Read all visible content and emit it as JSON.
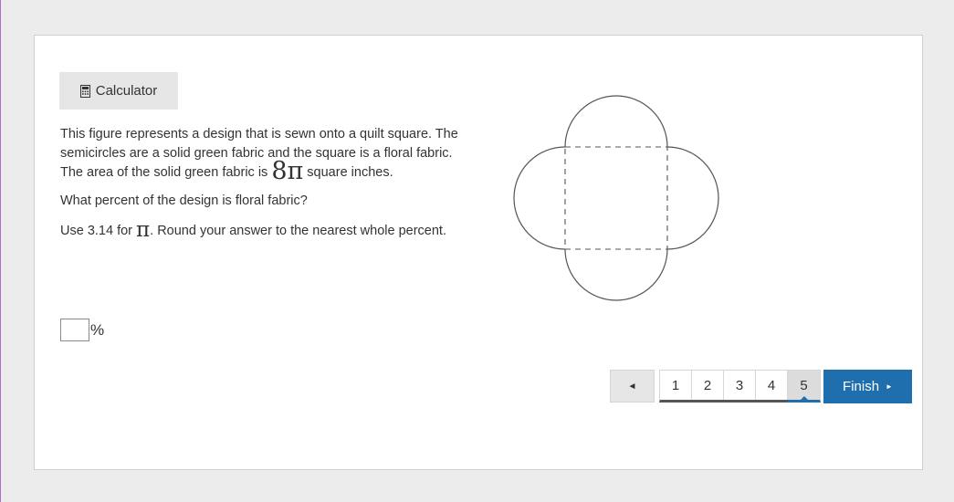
{
  "toolbar": {
    "calculator_label": "Calculator",
    "calculator_icon": "calculator-icon"
  },
  "problem": {
    "line1": "This figure represents a design that is sewn onto a quilt square. The semicircles are a solid green fabric and the square is a floral fabric. The area of the solid green fabric is ",
    "area_math": "8π",
    "line1_end": " square inches.",
    "question": "What percent of the design is floral fabric?",
    "use_prefix": "Use 3.14 for ",
    "pi_symbol": "π",
    "use_suffix": ". Round your answer to the nearest whole percent."
  },
  "answer": {
    "value": "",
    "unit": "%"
  },
  "navigation": {
    "prev_icon": "◄",
    "pages": [
      "1",
      "2",
      "3",
      "4",
      "5"
    ],
    "current_page": "5",
    "finish_label": "Finish",
    "finish_icon": "►"
  },
  "colors": {
    "accent": "#1f6fae",
    "button_gray": "#e6e6e6",
    "background": "#ececec"
  }
}
